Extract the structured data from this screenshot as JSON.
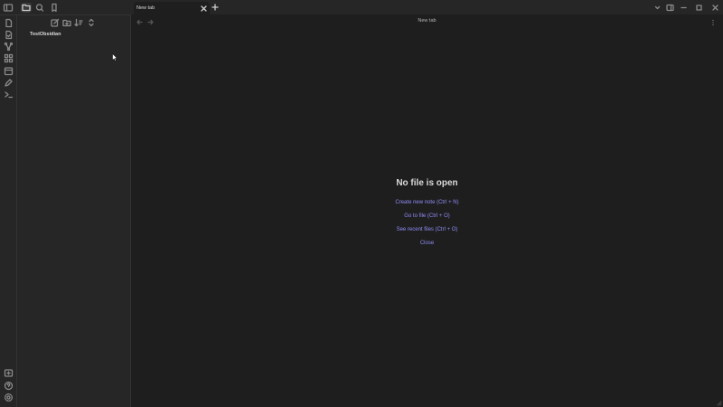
{
  "sidebar": {
    "vault_name": "TestObsidian"
  },
  "tabs": [
    {
      "label": "New tab",
      "active": true
    }
  ],
  "main": {
    "view_title": "New tab",
    "empty_state": {
      "title": "No file is open",
      "actions": [
        {
          "label": "Create new note (Ctrl + N)"
        },
        {
          "label": "Go to file (Ctrl + O)"
        },
        {
          "label": "See recent files (Ctrl + O)"
        },
        {
          "label": "Close"
        }
      ]
    }
  },
  "colors": {
    "accent": "#8f8cf5",
    "background": "#1e1e1e",
    "panel": "#262626"
  },
  "icons": {
    "ribbon_top": [
      "file-icon",
      "files-icon",
      "graph-icon",
      "canvas-icon",
      "calendar-icon",
      "templates-icon",
      "terminal-icon"
    ],
    "ribbon_bottom": [
      "vault-switch-icon",
      "help-icon",
      "settings-icon"
    ]
  }
}
